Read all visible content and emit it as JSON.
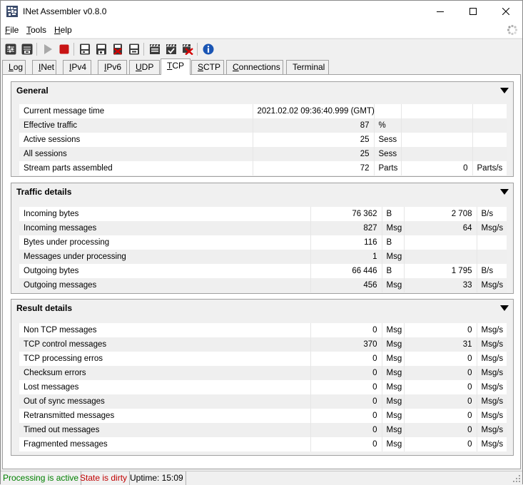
{
  "window": {
    "title": "INet Assembler v0.8.0"
  },
  "menu": {
    "file": {
      "first": "F",
      "rest": "ile"
    },
    "tools": {
      "first": "T",
      "rest": "ools"
    },
    "help": {
      "first": "H",
      "rest": "elp"
    }
  },
  "toolbar": {
    "icons": [
      "load-settings-icon",
      "save-settings-icon",
      "play-icon",
      "stop-icon",
      "load-icon",
      "save-icon",
      "clear-icon",
      "export-icon",
      "clapper-icon",
      "clapper-check-icon",
      "clapper-clear-icon",
      "info-icon"
    ]
  },
  "tabs": [
    {
      "first": "L",
      "rest": "og",
      "active": false
    },
    {
      "first": "I",
      "rest": "Net",
      "active": false
    },
    {
      "first": "I",
      "rest": "Pv4",
      "active": false
    },
    {
      "first": "I",
      "rest": "Pv6",
      "active": false
    },
    {
      "first": "U",
      "rest": "DP",
      "active": false
    },
    {
      "first": "T",
      "rest": "CP",
      "active": true
    },
    {
      "first": "S",
      "rest": "CTP",
      "active": false
    },
    {
      "first": "C",
      "rest": "onnections",
      "active": false
    },
    {
      "first": "",
      "rest": "Terminal",
      "active": false
    }
  ],
  "general": {
    "title": "General",
    "rows": [
      {
        "label": "Current message time",
        "value": "2021.02.02 09:36:40.999 (GMT)",
        "unit": "",
        "rate": "",
        "rate_unit": ""
      },
      {
        "label": "Effective traffic",
        "value": "87",
        "unit": "%",
        "rate": "",
        "rate_unit": ""
      },
      {
        "label": "Active sessions",
        "value": "25",
        "unit": "Sess",
        "rate": "",
        "rate_unit": ""
      },
      {
        "label": "All sessions",
        "value": "25",
        "unit": "Sess",
        "rate": "",
        "rate_unit": ""
      },
      {
        "label": "Stream parts assembled",
        "value": "72",
        "unit": "Parts",
        "rate": "0",
        "rate_unit": "Parts/s"
      }
    ]
  },
  "traffic": {
    "title": "Traffic details",
    "rows": [
      {
        "label": "Incoming bytes",
        "value": "76 362",
        "unit": "B",
        "rate": "2 708",
        "rate_unit": "B/s"
      },
      {
        "label": "Incoming messages",
        "value": "827",
        "unit": "Msg",
        "rate": "64",
        "rate_unit": "Msg/s"
      },
      {
        "label": "Bytes under processing",
        "value": "116",
        "unit": "B",
        "rate": "",
        "rate_unit": ""
      },
      {
        "label": "Messages under processing",
        "value": "1",
        "unit": "Msg",
        "rate": "",
        "rate_unit": ""
      },
      {
        "label": "Outgoing bytes",
        "value": "66 446",
        "unit": "B",
        "rate": "1 795",
        "rate_unit": "B/s"
      },
      {
        "label": "Outgoing messages",
        "value": "456",
        "unit": "Msg",
        "rate": "33",
        "rate_unit": "Msg/s"
      }
    ]
  },
  "result": {
    "title": "Result details",
    "rows": [
      {
        "label": "Non TCP messages",
        "value": "0",
        "unit": "Msg",
        "rate": "0",
        "rate_unit": "Msg/s"
      },
      {
        "label": "TCP control messages",
        "value": "370",
        "unit": "Msg",
        "rate": "31",
        "rate_unit": "Msg/s"
      },
      {
        "label": "TCP processing erros",
        "value": "0",
        "unit": "Msg",
        "rate": "0",
        "rate_unit": "Msg/s"
      },
      {
        "label": "Checksum errors",
        "value": "0",
        "unit": "Msg",
        "rate": "0",
        "rate_unit": "Msg/s"
      },
      {
        "label": "Lost messages",
        "value": "0",
        "unit": "Msg",
        "rate": "0",
        "rate_unit": "Msg/s"
      },
      {
        "label": "Out of sync messages",
        "value": "0",
        "unit": "Msg",
        "rate": "0",
        "rate_unit": "Msg/s"
      },
      {
        "label": "Retransmitted messages",
        "value": "0",
        "unit": "Msg",
        "rate": "0",
        "rate_unit": "Msg/s"
      },
      {
        "label": "Timed out messages",
        "value": "0",
        "unit": "Msg",
        "rate": "0",
        "rate_unit": "Msg/s"
      },
      {
        "label": "Fragmented messages",
        "value": "0",
        "unit": "Msg",
        "rate": "0",
        "rate_unit": "Msg/s"
      }
    ]
  },
  "status": {
    "processing": "Processing is active",
    "state": "State is dirty",
    "uptime": "Uptime: 15:09",
    "colors": {
      "processing": "#008000",
      "state": "#c00000"
    }
  }
}
